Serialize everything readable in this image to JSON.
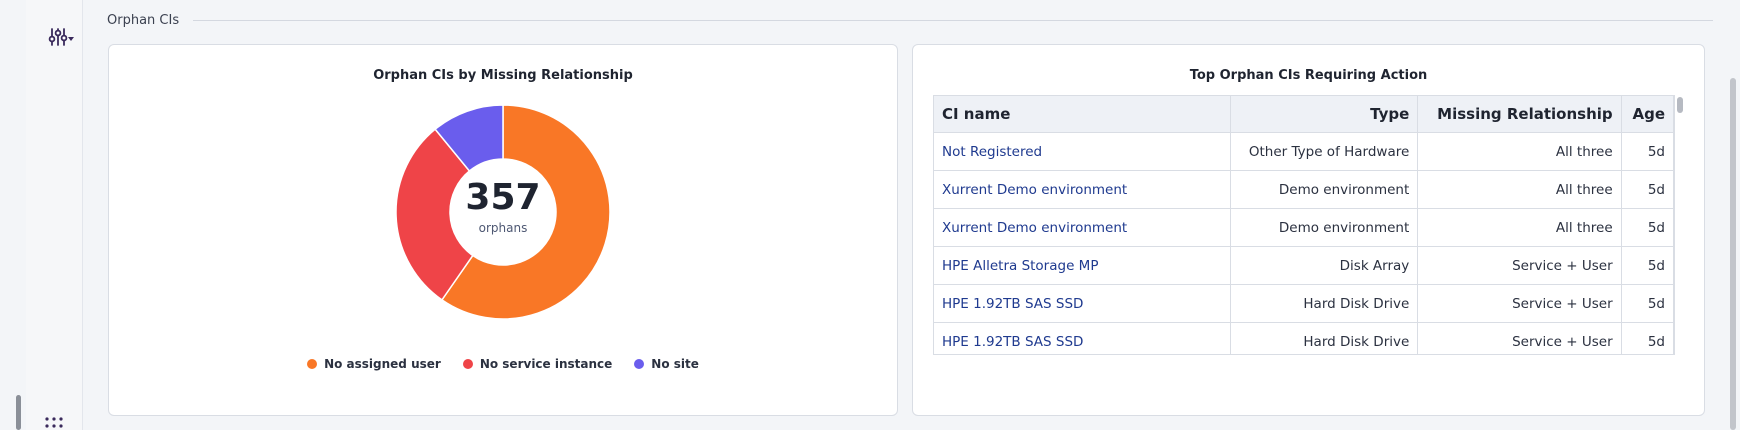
{
  "section": {
    "title": "Orphan CIs"
  },
  "colors": {
    "orange": "#f97726",
    "red": "#ef4448",
    "purple": "#6a5ded",
    "link": "#1f3a8f"
  },
  "icons": {
    "filter": "sliders-dropdown-icon",
    "grid": "dots-grid-icon"
  },
  "donut_card": {
    "title": "Orphan CIs by Missing Relationship",
    "center_value": "357",
    "center_label": "orphans"
  },
  "chart_data": {
    "type": "pie",
    "title": "Orphan CIs by Missing Relationship",
    "total": 357,
    "labels": [
      "No assigned user",
      "No service instance",
      "No site"
    ],
    "values": [
      213,
      105,
      39
    ],
    "colors": [
      "#f97726",
      "#ef4448",
      "#6a5ded"
    ],
    "legend_position": "bottom"
  },
  "table_card": {
    "title": "Top Orphan CIs Requiring Action",
    "columns": [
      "CI name",
      "Type",
      "Missing Relationship",
      "Age"
    ],
    "rows": [
      {
        "name": "Not Registered",
        "type": "Other Type of Hardware",
        "missing": "All three",
        "age": "5d"
      },
      {
        "name": "Xurrent Demo environment",
        "type": "Demo environment",
        "missing": "All three",
        "age": "5d"
      },
      {
        "name": "Xurrent Demo environment",
        "type": "Demo environment",
        "missing": "All three",
        "age": "5d"
      },
      {
        "name": "HPE Alletra Storage MP",
        "type": "Disk Array",
        "missing": "Service + User",
        "age": "5d"
      },
      {
        "name": "HPE 1.92TB SAS SSD",
        "type": "Hard Disk Drive",
        "missing": "Service + User",
        "age": "5d"
      },
      {
        "name": "HPE 1.92TB SAS SSD",
        "type": "Hard Disk Drive",
        "missing": "Service + User",
        "age": "5d"
      }
    ]
  }
}
